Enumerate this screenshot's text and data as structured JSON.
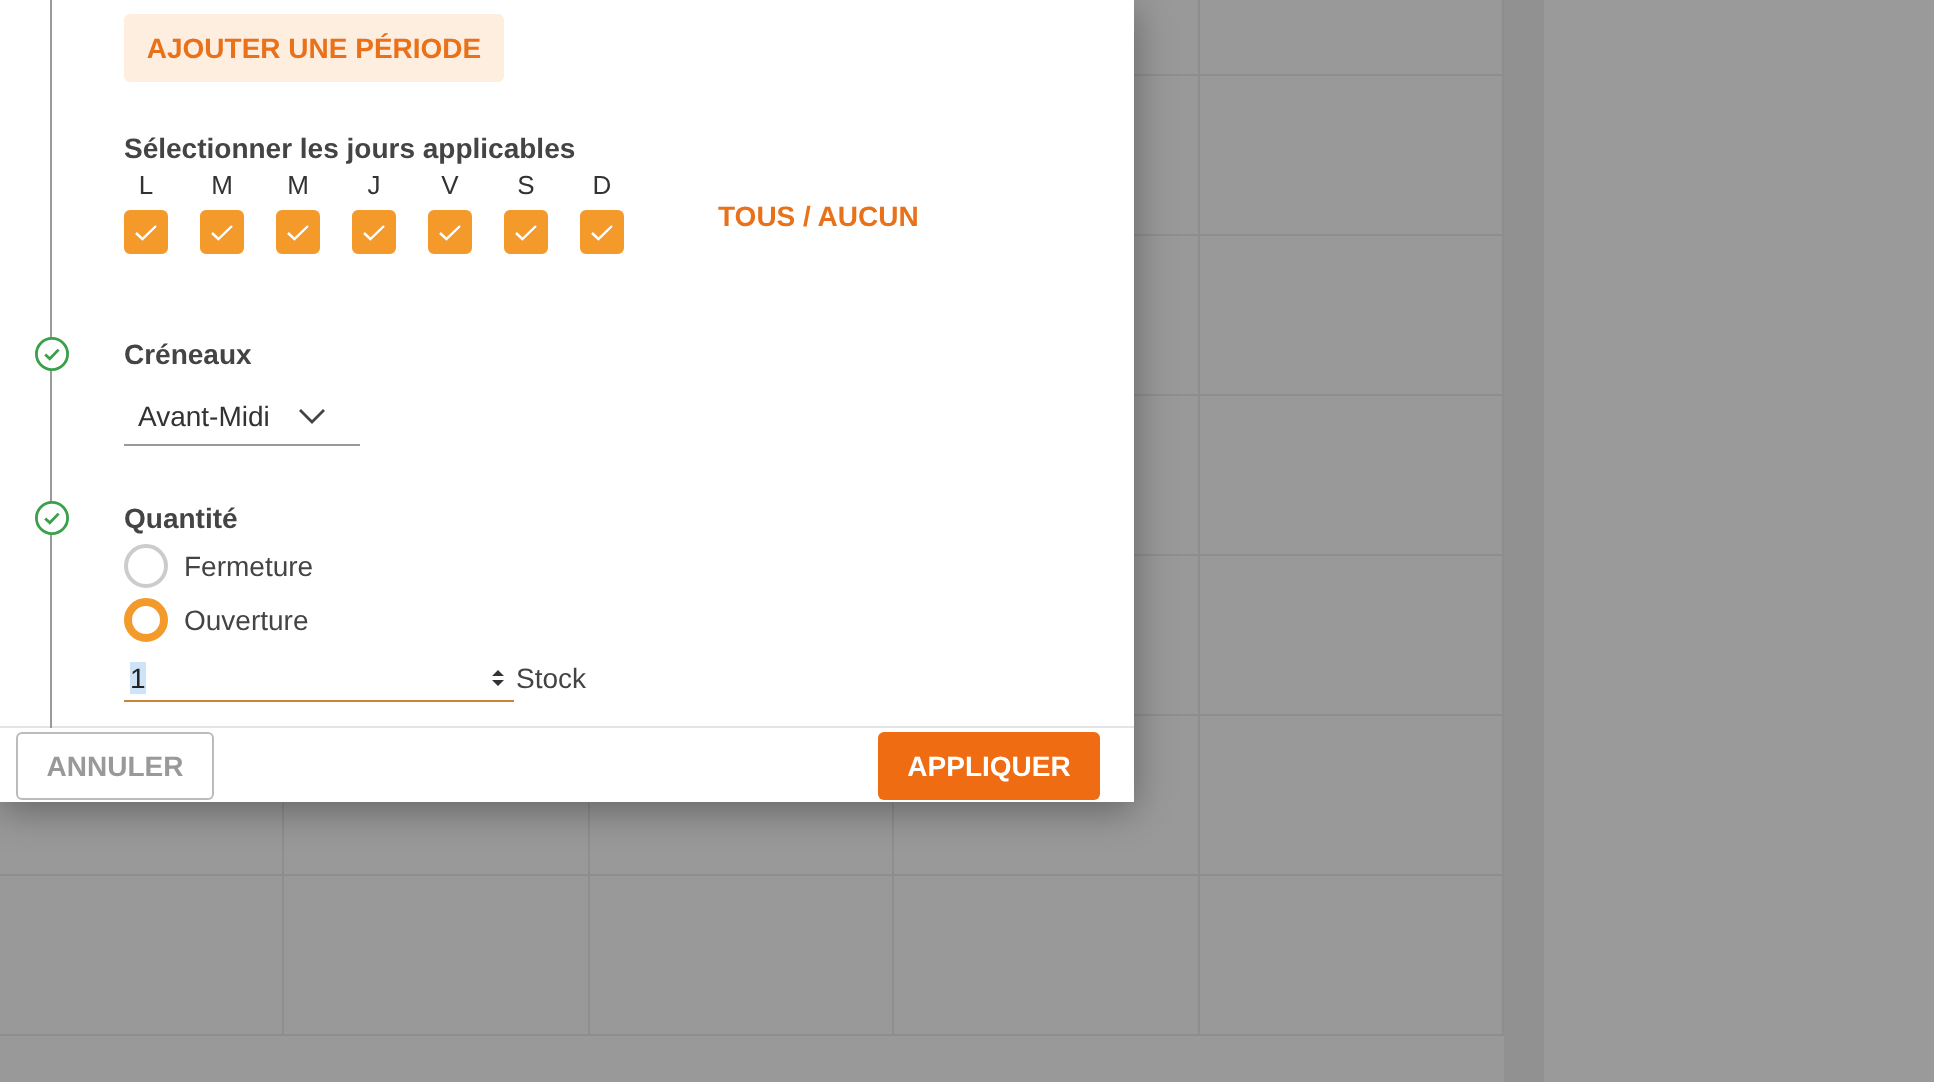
{
  "add_period_button": "AJOUTER UNE PÉRIODE",
  "days": {
    "label": "Sélectionner les jours applicables",
    "toggle_all": "TOUS / AUCUN",
    "items": [
      {
        "letter": "L",
        "checked": true
      },
      {
        "letter": "M",
        "checked": true
      },
      {
        "letter": "M",
        "checked": true
      },
      {
        "letter": "J",
        "checked": true
      },
      {
        "letter": "V",
        "checked": true
      },
      {
        "letter": "S",
        "checked": true
      },
      {
        "letter": "D",
        "checked": true
      }
    ]
  },
  "slots": {
    "label": "Créneaux",
    "done": true,
    "value": "Avant-Midi"
  },
  "quantity": {
    "label": "Quantité",
    "done": true,
    "options": [
      {
        "label": "Fermeture",
        "selected": false
      },
      {
        "label": "Ouverture",
        "selected": true
      }
    ],
    "value": "1",
    "unit": "Stock"
  },
  "buttons": {
    "cancel": "ANNULER",
    "apply": "APPLIQUER"
  }
}
